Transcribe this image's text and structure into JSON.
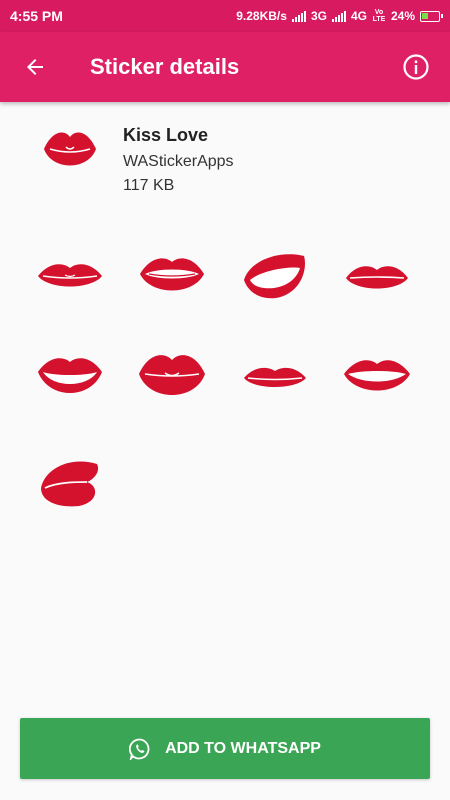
{
  "status_bar": {
    "time": "4:55 PM",
    "network_speed": "9.28KB/s",
    "network_3g": "3G",
    "network_4g": "4G",
    "volte": "Vo LTE",
    "battery": "24%"
  },
  "app_bar": {
    "title": "Sticker details"
  },
  "pack": {
    "name": "Kiss Love",
    "publisher": "WAStickerApps",
    "size": "117 KB"
  },
  "colors": {
    "status_bar": "#d81b60",
    "app_bar": "#e02065",
    "lips": "#d4122e",
    "add_button": "#3aa655"
  },
  "stickers": [
    {
      "icon": "lips-closed-icon"
    },
    {
      "icon": "lips-smile-icon"
    },
    {
      "icon": "lips-side-open-icon"
    },
    {
      "icon": "lips-thin-icon"
    },
    {
      "icon": "lips-grin-icon"
    },
    {
      "icon": "lips-pout-icon"
    },
    {
      "icon": "lips-narrow-icon"
    },
    {
      "icon": "lips-wide-smile-icon"
    },
    {
      "icon": "lips-side-kiss-icon"
    }
  ],
  "add_button": {
    "label": "ADD TO WHATSAPP",
    "icon": "whatsapp-icon"
  }
}
